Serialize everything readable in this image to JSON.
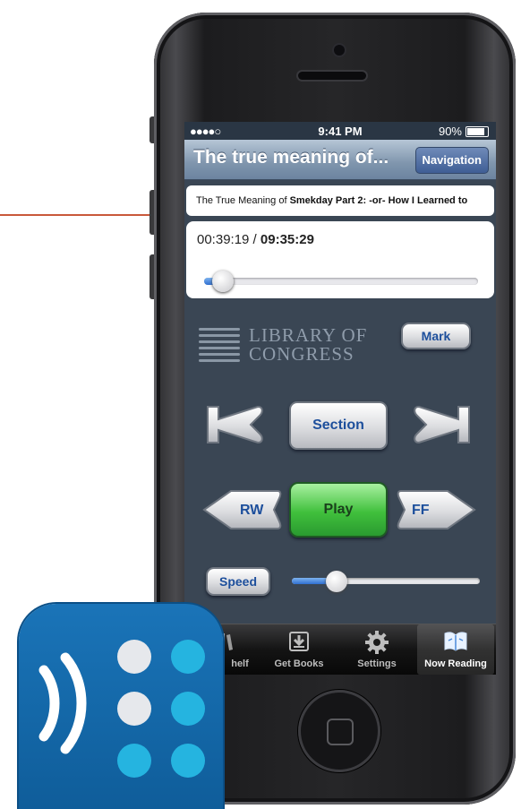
{
  "status_bar": {
    "signal": "●●●●○",
    "time": "9:41 PM",
    "battery": "90%"
  },
  "nav_bar": {
    "title": "The true meaning of...",
    "navigation_button": "Navigation"
  },
  "book": {
    "title_prefix": "The True Meaning of ",
    "title_bold": "Smekday Part 2: -or- How I Learned to"
  },
  "playback": {
    "elapsed": "00:39:19",
    "separator": " / ",
    "total": "09:35:29",
    "progress_fraction": 0.068,
    "speed_fraction": 0.24
  },
  "logo": {
    "line1": "LIBRARY OF",
    "line2": "CONGRESS"
  },
  "controls": {
    "mark": "Mark",
    "section": "Section",
    "rewind": "RW",
    "play": "Play",
    "fast_forward": "FF",
    "speed": "Speed"
  },
  "tabs": [
    {
      "label": "Shelf",
      "visible_label": "helf",
      "icon": "bookshelf-icon"
    },
    {
      "label": "Get Books",
      "icon": "download-icon"
    },
    {
      "label": "Settings",
      "icon": "gear-icon"
    },
    {
      "label": "Now Reading",
      "icon": "open-book-icon"
    }
  ],
  "colors": {
    "accent_blue": "#1d4f9c",
    "play_green": "#40c03c",
    "pointer_line": "#c9593b",
    "app_icon_blue": "#1a74b8"
  }
}
